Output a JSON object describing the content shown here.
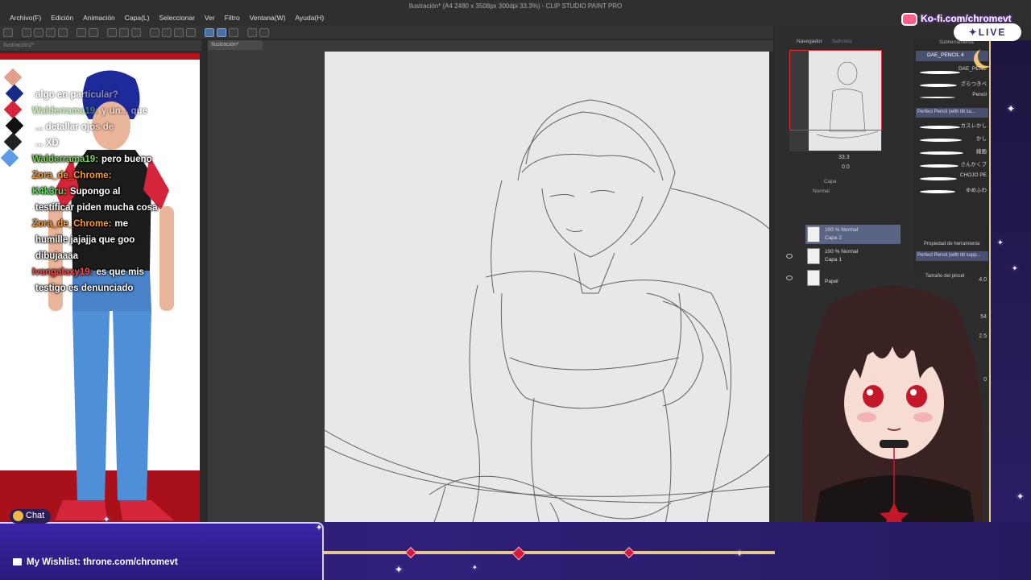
{
  "app": {
    "title": "Ilustración* (A4 2480 x 3508px 300dpi 33.3%) - CLIP STUDIO PAINT PRO",
    "doc_tab": "Ilustración*",
    "left_doc_tab": "Ilustración2*"
  },
  "menu": [
    "Archivo(F)",
    "Edición",
    "Animación",
    "Capa(L)",
    "Seleccionar",
    "Ver",
    "Filtro",
    "Ventana(W)",
    "Ayuda(H)"
  ],
  "chat": {
    "messages": [
      {
        "user": "",
        "text": "algo en particular?",
        "user_color": "#ffffff",
        "faded": true
      },
      {
        "user": "Walderrama19:",
        "text": "y un... que",
        "user_color": "#7dd35a",
        "faded": true
      },
      {
        "user": "",
        "text": "... detallar ojos de",
        "user_color": "#ffffff",
        "faded": true
      },
      {
        "user": "",
        "text": "... XD",
        "user_color": "#ffffff",
        "faded": true
      },
      {
        "user": "Walderrama19:",
        "text": "pero bueno",
        "user_color": "#7dd35a",
        "faded": false
      },
      {
        "user": "Zora_de_Chrome:",
        "text": "",
        "user_color": "#ff9a2e",
        "faded": false
      },
      {
        "user": "K4k3ru:",
        "text": "Supongo al",
        "user_color": "#5ee05e",
        "faded": false
      },
      {
        "user": "",
        "text": "testificar piden mucha cosa",
        "user_color": "#ffffff",
        "faded": false
      },
      {
        "user": "Zora_de_Chrome:",
        "text": "me",
        "user_color": "#ff9a2e",
        "faded": false
      },
      {
        "user": "",
        "text": "humille jajajja que goo",
        "user_color": "#ffffff",
        "faded": false
      },
      {
        "user": "",
        "text": "dibujaaaa",
        "user_color": "#ffffff",
        "faded": false
      },
      {
        "user": "Ivangalaxy19:",
        "text": "es que mis",
        "user_color": "#ff4a4a",
        "faded": false
      },
      {
        "user": "",
        "text": "testigo es denunciado",
        "user_color": "#ffffff",
        "faded": false
      }
    ],
    "badge_label": "Chat"
  },
  "overlay": {
    "wishlist": "My Wishlist: throne.com/chromevt",
    "kofi": "Ko-fi.com/chromevt",
    "live": "LIVE"
  },
  "navigator": {
    "tab1": "Navegador",
    "tab2": "Subvista",
    "zoom": "33.3",
    "rotation": "0.0"
  },
  "layers": {
    "header": "Capa",
    "blend": "Normal",
    "items": [
      {
        "opacity": "100 % Normal",
        "name": "Capa 2"
      },
      {
        "opacity": "100 % Normal",
        "name": "Capa 1"
      },
      {
        "opacity": "",
        "name": "Papel"
      }
    ]
  },
  "brushes": {
    "header": "Subherramienta",
    "selected": "DAE_PENCIL 4",
    "items": [
      "DAE_PENC",
      "ざらつきペ",
      "Pencil",
      "カスレかし",
      "かし",
      "線画",
      "さんかくプ",
      "CHOJO PE",
      "ゆめふわ"
    ],
    "highlighted": "Perfect Pencil (with tilt su..."
  },
  "tool_property": {
    "header": "Propiedad de herramienta",
    "selected": "Perfect Pencil (with tilt supp...",
    "brush_size_label": "Tamaño del pincel",
    "brush_size": "4.0",
    "val2": "54",
    "val3": "2.5",
    "val4": "0"
  },
  "colors": {
    "chat_red": "#b5121b",
    "overlay_purple": "#2b1b7a",
    "gold": "#e7c88a",
    "accent_gem": "#d21c3a"
  }
}
